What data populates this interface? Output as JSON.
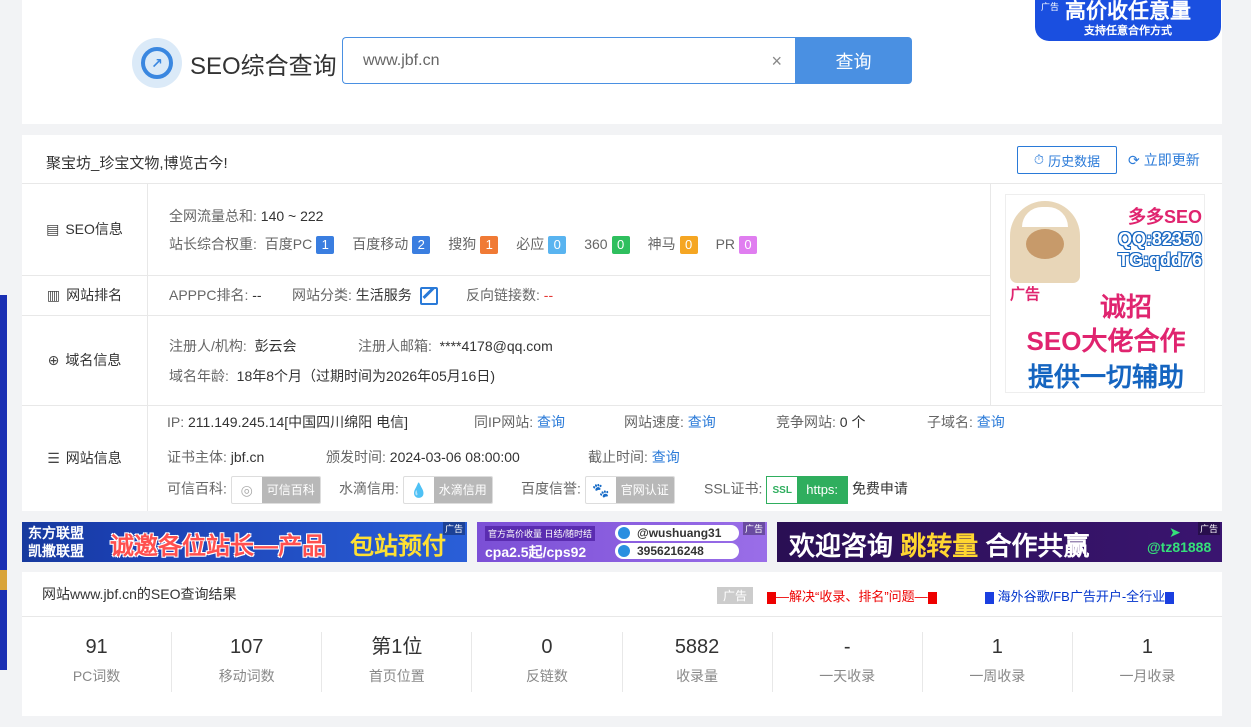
{
  "header": {
    "logo_text": "SEO综合查询",
    "search_value": "www.jbf.cn",
    "search_clear": "×",
    "search_button": "查询",
    "top_ad": {
      "tag": "广告",
      "line1": "高价收任意量",
      "line2": "支持任意合作方式"
    }
  },
  "info": {
    "site_title": "聚宝坊_珍宝文物,博览古今!",
    "history_button": "历史数据",
    "refresh_button": "立即更新",
    "seo_info": {
      "label": "SEO信息",
      "traffic_label": "全网流量总和:",
      "traffic_value": "140 ~ 222",
      "weight_label": "站长综合权重:",
      "weights": [
        {
          "name": "百度PC",
          "value": "1",
          "color": "#3a7ee0"
        },
        {
          "name": "百度移动",
          "value": "2",
          "color": "#3a7ee0"
        },
        {
          "name": "搜狗",
          "value": "1",
          "color": "#f07a35"
        },
        {
          "name": "必应",
          "value": "0",
          "color": "#59b4f0"
        },
        {
          "name": "360",
          "value": "0",
          "color": "#2fbf5e"
        },
        {
          "name": "神马",
          "value": "0",
          "color": "#f5a623"
        },
        {
          "name": "PR",
          "value": "0",
          "color": "#e07ef0"
        }
      ]
    },
    "rank": {
      "label": "网站排名",
      "apppc_label": "APPPC排名:",
      "apppc_value": "--",
      "category_label": "网站分类:",
      "category_value": "生活服务",
      "backlink_label": "反向链接数:",
      "backlink_value": "--"
    },
    "domain": {
      "label": "域名信息",
      "registrant_label": "注册人/机构:",
      "registrant_value": "彭云会",
      "email_label": "注册人邮箱:",
      "email_value": "****4178@qq.com",
      "age_label": "域名年龄:",
      "age_value": "18年8个月（过期时间为2026年05月16日)"
    },
    "site": {
      "label": "网站信息",
      "ip_label": "IP:",
      "ip_value": "211.149.245.14[中国四川绵阳 电信]",
      "same_ip_label": "同IP网站:",
      "same_ip_link": "查询",
      "speed_label": "网站速度:",
      "speed_link": "查询",
      "compete_label": "竞争网站:",
      "compete_value": "0 个",
      "subdomain_label": "子域名:",
      "subdomain_link": "查询",
      "cert_subject_label": "证书主体:",
      "cert_subject_value": "jbf.cn",
      "issue_label": "颁发时间:",
      "issue_value": "2024-03-06 08:00:00",
      "expire_label": "截止时间:",
      "expire_link": "查询",
      "baike_label": "可信百科:",
      "baike_badge": "可信百科",
      "shuidi_label": "水滴信用:",
      "shuidi_badge": "水滴信用",
      "baidu_label": "百度信誉:",
      "baidu_badge": "官网认证",
      "ssl_label": "SSL证书:",
      "ssl_icon": "SSL",
      "ssl_badge": "https:",
      "ssl_apply": "免费申请"
    },
    "right_ad": {
      "line1": "多多SEO",
      "line2": "QQ:82350",
      "line3": "TG:qdd76",
      "tag": "广告",
      "line4": "诚招",
      "line5": "SEO大佬合作",
      "line6": "提供一切辅助"
    }
  },
  "banners": {
    "b1": {
      "left1": "东方联盟",
      "left2": "凯撒联盟",
      "mid": "诚邀各位站长—产品",
      "right": "包站预付",
      "tag": "广告"
    },
    "b2": {
      "a1": "官方高价收量 日结/随时结",
      "a2": "cpa2.5起/cps92",
      "p1": "@wushuang31",
      "p2": "3956216248",
      "tag": "广告"
    },
    "b3": {
      "t1": "欢迎咨询 ",
      "t2": "跳转量",
      "t3": " 合作共赢",
      "tg": "@tz81888",
      "tag": "广告"
    }
  },
  "results": {
    "title": "网站www.jbf.cn的SEO查询结果",
    "ad_gray": "广告",
    "ad_red": "—解决“收录、排名”问题—",
    "ad_blue": "海外谷歌/FB广告开户-全行业",
    "stats": [
      {
        "num": "91",
        "label": "PC词数"
      },
      {
        "num": "107",
        "label": "移动词数"
      },
      {
        "num": "第1位",
        "label": "首页位置"
      },
      {
        "num": "0",
        "label": "反链数"
      },
      {
        "num": "5882",
        "label": "收录量"
      },
      {
        "num": "-",
        "label": "一天收录"
      },
      {
        "num": "1",
        "label": "一周收录"
      },
      {
        "num": "1",
        "label": "一月收录"
      }
    ]
  }
}
